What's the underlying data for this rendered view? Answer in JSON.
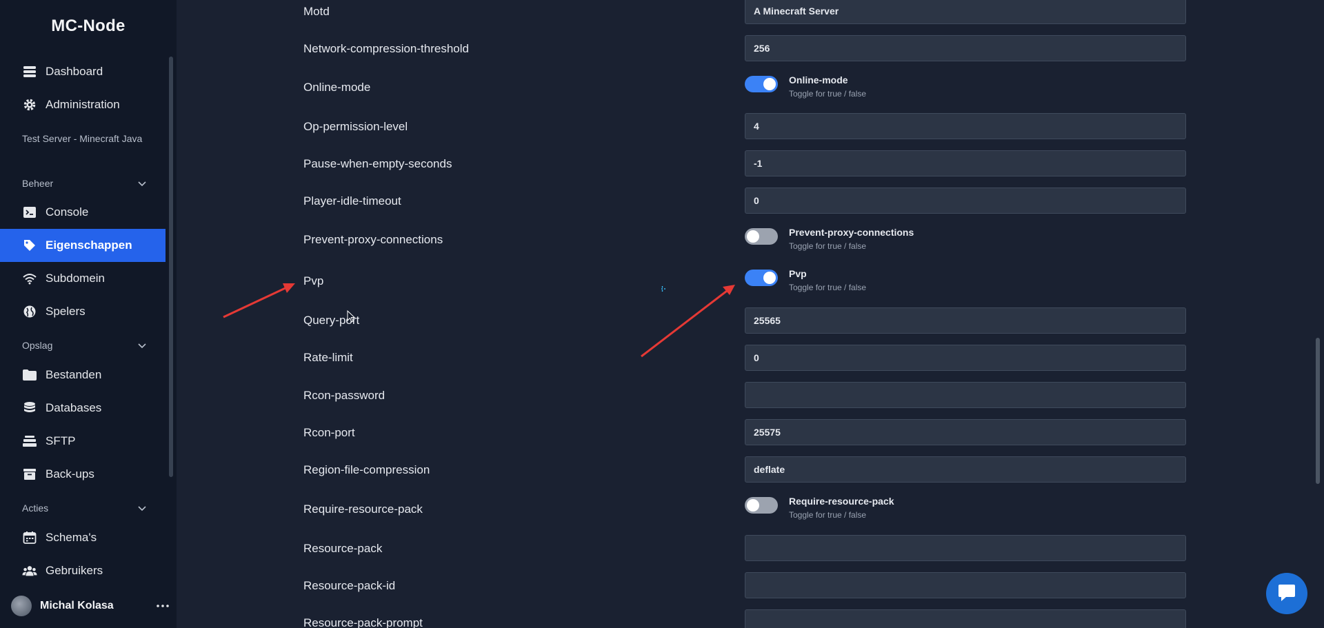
{
  "app": {
    "brand": "MC-Node"
  },
  "sidebar": {
    "top_items": [
      {
        "label": "Dashboard",
        "icon": "dashboard-icon"
      },
      {
        "label": "Administration",
        "icon": "gear-icon"
      }
    ],
    "server_name": "Test Server - Minecraft Java",
    "sections": [
      {
        "title": "Beheer",
        "items": [
          {
            "label": "Console",
            "icon": "terminal-icon"
          },
          {
            "label": "Eigenschappen",
            "icon": "tag-icon",
            "active": true
          },
          {
            "label": "Subdomein",
            "icon": "wifi-icon"
          },
          {
            "label": "Spelers",
            "icon": "globe-icon"
          }
        ]
      },
      {
        "title": "Opslag",
        "items": [
          {
            "label": "Bestanden",
            "icon": "folder-icon"
          },
          {
            "label": "Databases",
            "icon": "database-icon"
          },
          {
            "label": "SFTP",
            "icon": "server-icon"
          },
          {
            "label": "Back-ups",
            "icon": "archive-icon"
          }
        ]
      },
      {
        "title": "Acties",
        "items": [
          {
            "label": "Schema's",
            "icon": "calendar-icon"
          },
          {
            "label": "Gebruikers",
            "icon": "users-icon"
          }
        ]
      }
    ],
    "user": {
      "name": "Michal Kolasa"
    }
  },
  "properties": {
    "motd": {
      "label": "Motd",
      "value": "A Minecraft Server"
    },
    "network_compression_threshold": {
      "label": "Network-compression-threshold",
      "value": "256"
    },
    "online_mode": {
      "label": "Online-mode",
      "title": "Online-mode",
      "help": "Toggle for true / false",
      "enabled": true
    },
    "op_permission_level": {
      "label": "Op-permission-level",
      "value": "4"
    },
    "pause_when_empty_seconds": {
      "label": "Pause-when-empty-seconds",
      "value": "-1"
    },
    "player_idle_timeout": {
      "label": "Player-idle-timeout",
      "value": "0"
    },
    "prevent_proxy_connections": {
      "label": "Prevent-proxy-connections",
      "title": "Prevent-proxy-connections",
      "help": "Toggle for true / false",
      "enabled": false
    },
    "pvp": {
      "label": "Pvp",
      "title": "Pvp",
      "help": "Toggle for true / false",
      "enabled": true
    },
    "query_port": {
      "label": "Query-port",
      "value": "25565"
    },
    "rate_limit": {
      "label": "Rate-limit",
      "value": "0"
    },
    "rcon_password": {
      "label": "Rcon-password",
      "value": ""
    },
    "rcon_port": {
      "label": "Rcon-port",
      "value": "25575"
    },
    "region_file_compression": {
      "label": "Region-file-compression",
      "value": "deflate"
    },
    "require_resource_pack": {
      "label": "Require-resource-pack",
      "title": "Require-resource-pack",
      "help": "Toggle for true / false",
      "enabled": false
    },
    "resource_pack": {
      "label": "Resource-pack",
      "value": ""
    },
    "resource_pack_id": {
      "label": "Resource-pack-id",
      "value": ""
    },
    "resource_pack_prompt": {
      "label": "Resource-pack-prompt",
      "value": ""
    }
  },
  "colors": {
    "accent": "#2563eb",
    "annotation_arrow": "#e53935",
    "toggle_on": "#3b82f6"
  }
}
